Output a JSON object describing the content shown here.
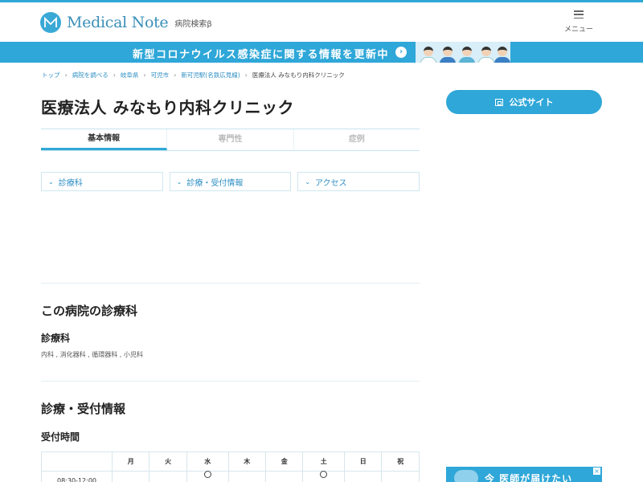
{
  "header": {
    "logo_text": "Medical Note",
    "logo_sub": "病院検索β",
    "menu_label": "メニュー"
  },
  "banner": {
    "text": "新型コロナウイルス感染症に関する情報を更新中",
    "arrow": "›"
  },
  "breadcrumb": [
    {
      "label": "トップ"
    },
    {
      "label": "病院を調べる"
    },
    {
      "label": "岐阜県"
    },
    {
      "label": "可児市"
    },
    {
      "label": "新可児駅(名鉄広見線)"
    },
    {
      "label": "医療法人 みなもり内科クリニック"
    }
  ],
  "page_title": "医療法人 みなもり内科クリニック",
  "official_site_label": "公式サイト",
  "tabs": [
    {
      "label": "基本情報",
      "active": true
    },
    {
      "label": "専門性",
      "active": false
    },
    {
      "label": "症例",
      "active": false
    }
  ],
  "anchors": [
    {
      "label": "診療科"
    },
    {
      "label": "診療・受付情報"
    },
    {
      "label": "アクセス"
    }
  ],
  "departments_section": {
    "title": "この病院の診療科",
    "subtitle": "診療科",
    "list": "内科 , 消化器科 , 循環器科 , 小児科"
  },
  "reception_section": {
    "title": "診療・受付情報",
    "subtitle": "受付時間"
  },
  "hours_table": {
    "days": [
      "月",
      "火",
      "水",
      "木",
      "金",
      "土",
      "日",
      "祝"
    ],
    "rows": [
      {
        "time": "08:30-12:00",
        "open": [
          false,
          false,
          true,
          false,
          false,
          true,
          false,
          false
        ]
      }
    ]
  },
  "ad": {
    "text": "今 医師が届けたい"
  },
  "colors": {
    "brand": "#2fa7d8",
    "link": "#2f8fc4"
  }
}
